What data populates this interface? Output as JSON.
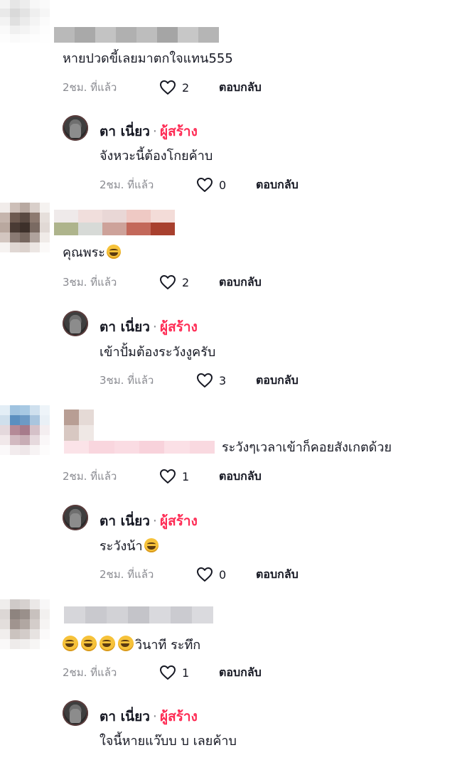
{
  "reply_label": "ตอบกลับ",
  "creator_name": "ตา เนี่ยว",
  "creator_tag": "ผู้สร้าง",
  "separator": "·",
  "comments": [
    {
      "text": "หายปวดขี้เลยมาตกใจแทน555",
      "time": "2ชม. ที่แล้ว",
      "likes": "2",
      "reply": {
        "text": "จังหวะนี้ต้องโกยค้าบ",
        "time": "2ชม. ที่แล้ว",
        "likes": "0"
      }
    },
    {
      "text": "คุณพระ",
      "time": "3ชม. ที่แล้ว",
      "likes": "2",
      "reply": {
        "text": "เข้าปั้มต้องระวังงูครับ",
        "time": "3ชม. ที่แล้ว",
        "likes": "3"
      }
    },
    {
      "text": "ระวังๆเวลาเข้าก็คอยสังเกตด้วย",
      "time": "2ชม. ที่แล้ว",
      "likes": "1",
      "reply": {
        "text": "ระวังน้า",
        "time": "2ชม. ที่แล้ว",
        "likes": "0"
      }
    },
    {
      "text": "วินาที ระทึก",
      "time": "2ชม. ที่แล้ว",
      "likes": "1",
      "reply": {
        "text": "ใจนี้หายแว๊บบ บ เลยค้าบ"
      }
    }
  ]
}
